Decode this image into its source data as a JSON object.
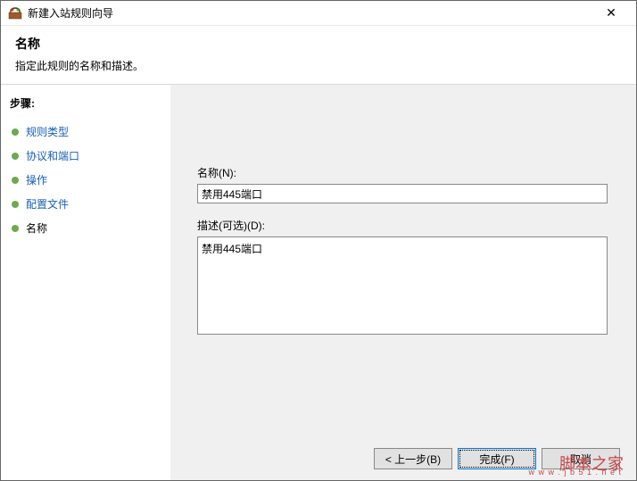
{
  "window": {
    "title": "新建入站规则向导",
    "close_glyph": "✕"
  },
  "header": {
    "title": "名称",
    "subtitle": "指定此规则的名称和描述。"
  },
  "sidebar": {
    "steps_label": "步骤:",
    "items": [
      {
        "label": "规则类型",
        "current": false
      },
      {
        "label": "协议和端口",
        "current": false
      },
      {
        "label": "操作",
        "current": false
      },
      {
        "label": "配置文件",
        "current": false
      },
      {
        "label": "名称",
        "current": true
      }
    ]
  },
  "form": {
    "name_label": "名称(N):",
    "name_value": "禁用445端口",
    "desc_label": "描述(可选)(D):",
    "desc_value": "禁用445端口"
  },
  "buttons": {
    "back": "< 上一步(B)",
    "finish": "完成(F)",
    "cancel": "取消"
  },
  "watermark": {
    "main": "脚本之家",
    "sub": "w w w . j b 5 1 . n e t"
  }
}
